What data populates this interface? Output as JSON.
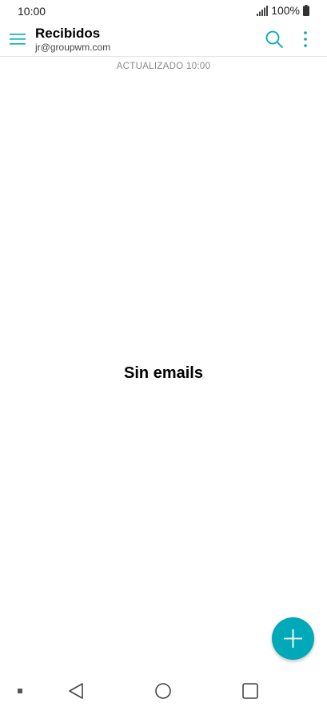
{
  "status_bar": {
    "time": "10:00",
    "battery": "100%"
  },
  "app_bar": {
    "title": "Recibidos",
    "account": "jr@groupwm.com"
  },
  "inbox": {
    "updated_label": "ACTUALIZADO 10:00",
    "empty_message": "Sin emails"
  },
  "icons": {
    "menu": "hamburger-menu-icon",
    "search": "search-icon",
    "more": "more-vert-icon",
    "compose": "plus-icon",
    "nav_back": "back-triangle-icon",
    "nav_home": "home-circle-icon",
    "nav_recents": "recents-square-icon"
  },
  "colors": {
    "accent": "#00a9b7",
    "secondary_text": "#8a8a8a"
  }
}
